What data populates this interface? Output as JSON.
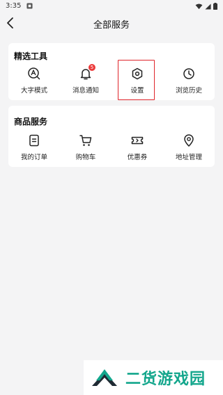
{
  "status_bar": {
    "time": "3:35"
  },
  "header": {
    "title": "全部服务"
  },
  "sections": [
    {
      "title": "精选工具",
      "items": [
        {
          "label": "大字模式",
          "icon": "font-size-icon"
        },
        {
          "label": "消息通知",
          "icon": "bell-icon",
          "badge": "5"
        },
        {
          "label": "设置",
          "icon": "settings-hexagon-icon",
          "highlighted": true
        },
        {
          "label": "浏览历史",
          "icon": "clock-icon"
        }
      ]
    },
    {
      "title": "商品服务",
      "items": [
        {
          "label": "我的订单",
          "icon": "order-icon"
        },
        {
          "label": "购物车",
          "icon": "cart-icon"
        },
        {
          "label": "优惠券",
          "icon": "coupon-icon"
        },
        {
          "label": "地址管理",
          "icon": "location-pin-icon"
        }
      ]
    }
  ],
  "watermark": {
    "text": "二货游戏园"
  },
  "colors": {
    "background": "#f4f4f5",
    "card": "#ffffff",
    "badge": "#ec3b3b",
    "highlight": "#e0242a",
    "watermark": "#13a68c"
  }
}
